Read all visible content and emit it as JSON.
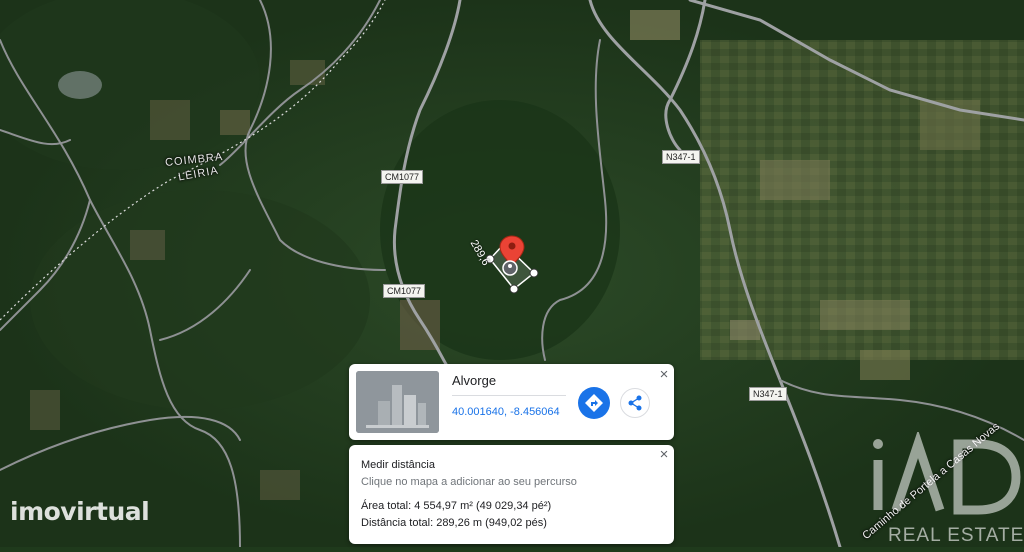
{
  "map": {
    "road_labels": [
      "CM1077",
      "CM1077",
      "N347-1",
      "N347-1"
    ],
    "boundary_labels": [
      "COIMBRA",
      "LEIRIA"
    ],
    "street_label": "Caminho de Portela a Casas Novas",
    "measure_label": "289,6"
  },
  "place_card": {
    "name": "Alvorge",
    "coordinates": "40.001640, -8.456064",
    "directions_icon": "directions-icon",
    "share_icon": "share-icon",
    "close_label": "×"
  },
  "measure_card": {
    "title": "Medir distância",
    "hint": "Clique no mapa a adicionar ao seu percurso",
    "area": "Área total: 4 554,97 m² (49 029,34 pé²)",
    "distance": "Distância total: 289,26 m (949,02 pés)",
    "close_label": "×"
  },
  "watermarks": {
    "left": "imovirtual",
    "right_logo": "iAD",
    "right_text": "REAL ESTATE"
  },
  "colors": {
    "accent": "#1a73e8",
    "pin": "#ea4335"
  }
}
